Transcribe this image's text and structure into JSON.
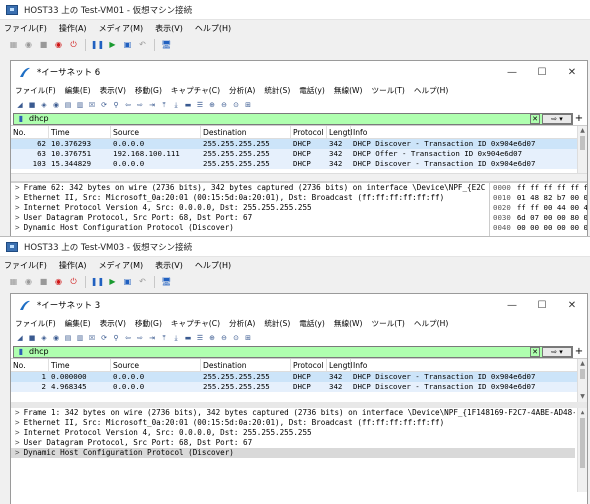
{
  "vm1": {
    "title": "HOST33 上の Test-VM01 - 仮想マシン接続",
    "menu": [
      "ファイル(F)",
      "操作(A)",
      "メディア(M)",
      "表示(V)",
      "ヘルプ(H)"
    ]
  },
  "ws1": {
    "title": "*イーサネット 6",
    "menu": [
      "ファイル(F)",
      "編集(E)",
      "表示(V)",
      "移動(G)",
      "キャプチャ(C)",
      "分析(A)",
      "統計(S)",
      "電話(y)",
      "無線(W)",
      "ツール(T)",
      "ヘルプ(H)"
    ],
    "filter": "dhcp",
    "columns": [
      "No.",
      "Time",
      "Source",
      "Destination",
      "Protocol",
      "Lengtl",
      "Info"
    ],
    "packets": [
      {
        "no": "62",
        "time": "10.376293",
        "src": "0.0.0.0",
        "dst": "255.255.255.255",
        "proto": "DHCP",
        "len": "342",
        "info": "DHCP Discover - Transaction ID 0x904e6d07"
      },
      {
        "no": "63",
        "time": "10.376751",
        "src": "192.168.100.111",
        "dst": "255.255.255.255",
        "proto": "DHCP",
        "len": "342",
        "info": "DHCP Offer    - Transaction ID 0x904e6d07"
      },
      {
        "no": "103",
        "time": "15.344829",
        "src": "0.0.0.0",
        "dst": "255.255.255.255",
        "proto": "DHCP",
        "len": "342",
        "info": "DHCP Discover - Transaction ID 0x904e6d07"
      }
    ],
    "details": [
      "Frame 62: 342 bytes on wire (2736 bits), 342 bytes captured (2736 bits) on interface \\Device\\NPF_{E2C",
      "Ethernet II, Src: Microsoft_0a:20:01 (00:15:5d:0a:20:01), Dst: Broadcast (ff:ff:ff:ff:ff:ff)",
      "Internet Protocol Version 4, Src: 0.0.0.0, Dst: 255.255.255.255",
      "User Datagram Protocol, Src Port: 68, Dst Port: 67",
      "Dynamic Host Configuration Protocol (Discover)"
    ],
    "hex": [
      {
        "off": "0000",
        "bytes": "ff ff ff ff ff ff"
      },
      {
        "off": "0010",
        "bytes": "01 48 82 b7 00 00"
      },
      {
        "off": "0020",
        "bytes": "ff ff 00 44 00 43"
      },
      {
        "off": "0030",
        "bytes": "6d 07 00 00 80 00"
      },
      {
        "off": "0040",
        "bytes": "00 00 00 00 00 00"
      }
    ]
  },
  "vm2": {
    "title": "HOST33 上の Test-VM03 - 仮想マシン接続",
    "menu": [
      "ファイル(F)",
      "操作(A)",
      "メディア(M)",
      "表示(V)",
      "ヘルプ(H)"
    ]
  },
  "ws2": {
    "title": "*イーサネット 3",
    "menu": [
      "ファイル(F)",
      "編集(E)",
      "表示(V)",
      "移動(G)",
      "キャプチャ(C)",
      "分析(A)",
      "統計(S)",
      "電話(y)",
      "無線(W)",
      "ツール(T)",
      "ヘルプ(H)"
    ],
    "filter": "dhcp",
    "columns": [
      "No.",
      "Time",
      "Source",
      "Destination",
      "Protocol",
      "Lengtl",
      "Info"
    ],
    "packets": [
      {
        "no": "1",
        "time": "0.000000",
        "src": "0.0.0.0",
        "dst": "255.255.255.255",
        "proto": "DHCP",
        "len": "342",
        "info": "DHCP Discover - Transaction ID 0x904e6d07"
      },
      {
        "no": "2",
        "time": "4.968345",
        "src": "0.0.0.0",
        "dst": "255.255.255.255",
        "proto": "DHCP",
        "len": "342",
        "info": "DHCP Discover - Transaction ID 0x904e6d07"
      }
    ],
    "details": [
      "Frame 1: 342 bytes on wire (2736 bits), 342 bytes captured (2736 bits) on interface \\Device\\NPF_{1F148169-F2C7-4ABE-AD48-4E",
      "Ethernet II, Src: Microsoft_0a:20:01 (00:15:5d:0a:20:01), Dst: Broadcast (ff:ff:ff:ff:ff:ff)",
      "Internet Protocol Version 4, Src: 0.0.0.0, Dst: 255.255.255.255",
      "User Datagram Protocol, Src Port: 68, Dst Port: 67",
      "Dynamic Host Configuration Protocol (Discover)"
    ]
  }
}
